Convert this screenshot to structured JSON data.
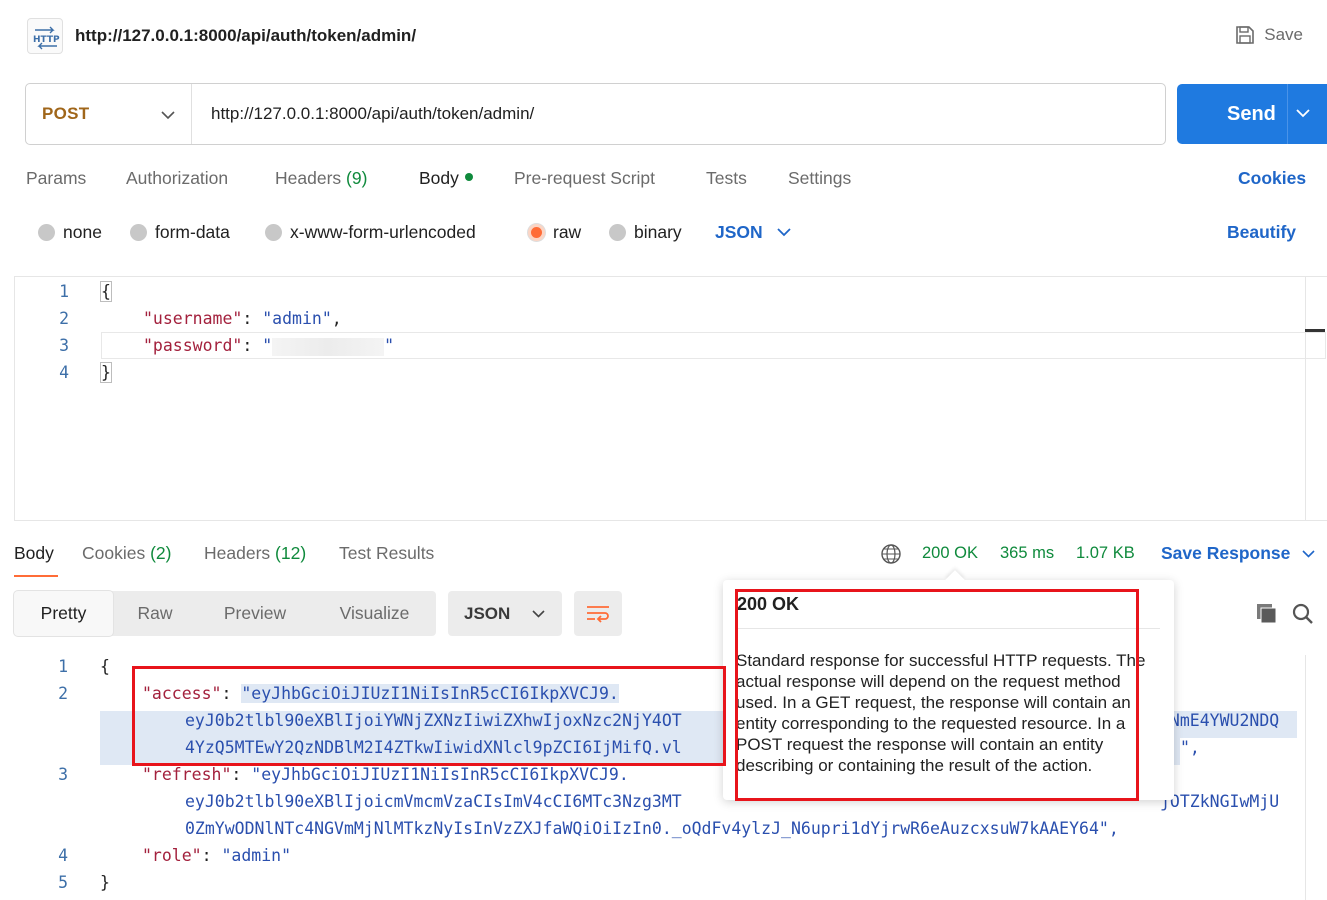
{
  "header": {
    "icon": "http-icon",
    "title": "http://127.0.0.1:8000/api/auth/token/admin/",
    "save_label": "Save"
  },
  "request": {
    "method": "POST",
    "url": "http://127.0.0.1:8000/api/auth/token/admin/",
    "send_label": "Send",
    "tabs": {
      "params": "Params",
      "authorization": "Authorization",
      "headers": "Headers",
      "headers_count": "(9)",
      "body": "Body",
      "prerequest": "Pre-request Script",
      "tests": "Tests",
      "settings": "Settings"
    },
    "cookies_label": "Cookies",
    "body_types": {
      "none": "none",
      "form_data": "form-data",
      "urlencoded": "x-www-form-urlencoded",
      "raw": "raw",
      "binary": "binary"
    },
    "selected_body_type": "raw",
    "format": "JSON",
    "beautify_label": "Beautify",
    "code": {
      "line_numbers": [
        "1",
        "2",
        "3",
        "4"
      ],
      "open_brace": "{",
      "close_brace": "}",
      "username_key": "\"username\"",
      "username_value": "\"admin\"",
      "password_key": "\"password\"",
      "password_value_open": "\"",
      "password_value_close": "\""
    }
  },
  "response": {
    "tabs": {
      "body": "Body",
      "cookies": "Cookies",
      "cookies_count": "(2)",
      "headers": "Headers",
      "headers_count": "(12)",
      "test_results": "Test Results"
    },
    "status": "200 OK",
    "time": "365 ms",
    "size": "1.07 KB",
    "save_response_label": "Save Response",
    "views": {
      "pretty": "Pretty",
      "raw": "Raw",
      "preview": "Preview",
      "visualize": "Visualize"
    },
    "format": "JSON",
    "code": {
      "line_numbers": [
        "1",
        "2",
        "3",
        "4",
        "5"
      ],
      "open_brace": "{",
      "close_brace": "}",
      "access_key": "\"access\"",
      "access_l1": "\"eyJhbGciOiJIUzI1NiIsInR5cCI6IkpXVCJ9.",
      "access_l2": "eyJ0b2tlbl90eXBlIjoiYWNjZXNzIiwiZXhwIjoxNzc2NjY4OT",
      "access_l2_tail": "nNmE4YWU2NDQ",
      "access_l3": "4YzQ5MTEwY2QzNDBlM2I4ZTkwIiwidXNlcl9pZCI6IjMifQ.vl",
      "access_l3_tail": "\",",
      "refresh_key": "\"refresh\"",
      "refresh_l1": "\"eyJhbGciOiJIUzI1NiIsInR5cCI6IkpXVCJ9.",
      "refresh_l2": "eyJ0b2tlbl90eXBlIjoicmVmcmVzaCIsImV4cCI6MTc3Nzg3MT",
      "refresh_l2_tail": "jOTZkNGIwMjU",
      "refresh_l3": "0ZmYwODNlNTc4NGVmMjNlMTkzNyIsInVzZXJfaWQiOiIzIn0._oQdFv4ylzJ_N6upri1dYjrwR6eAuzcxsuW7kAAEY64\",",
      "role_key": "\"role\"",
      "role_value": "\"admin\""
    }
  },
  "tooltip": {
    "title": "200 OK",
    "description": "Standard response for successful HTTP requests. The actual response will depend on the request method used. In a GET request, the response will contain an entity corresponding to the requested resource. In a POST request the response will contain an entity describing or containing the result of the action."
  },
  "colors": {
    "accent_orange": "#ff6c37",
    "send_blue": "#1f7ae0",
    "link_blue": "#1f66c8",
    "status_green": "#0f8a3c",
    "highlight_red": "#e8141b",
    "method_post": "#a0661a"
  }
}
